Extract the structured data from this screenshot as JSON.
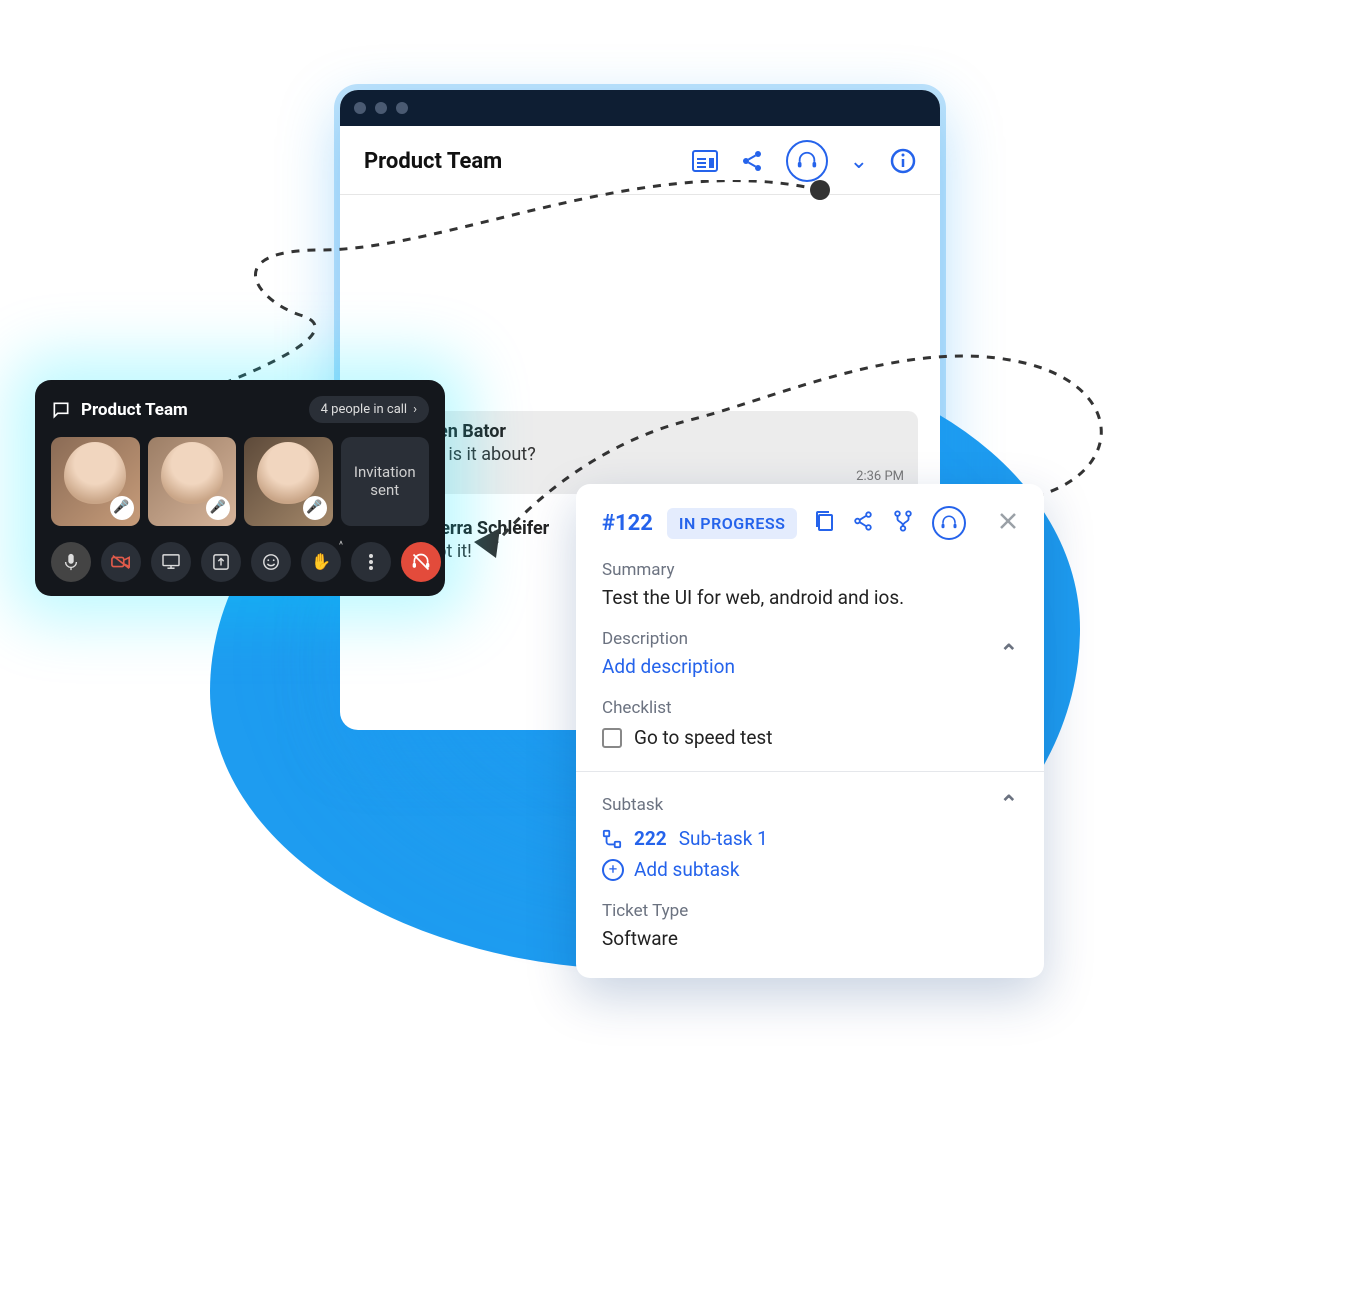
{
  "window": {
    "title": "Product Team",
    "messages": [
      {
        "name": "en Bator",
        "text": "t is it about?",
        "time": "2:36 PM"
      },
      {
        "name": "Kierra Schleifer",
        "text": "Got it!",
        "time": ""
      }
    ]
  },
  "call": {
    "title": "Product Team",
    "status": "4 people in call",
    "invite_label": "Invitation sent"
  },
  "ticket": {
    "id": "#122",
    "status": "IN PROGRESS",
    "summary_label": "Summary",
    "summary_text": "Test the UI for web, android and ios.",
    "description_label": "Description",
    "description_placeholder": "Add description",
    "checklist_label": "Checklist",
    "checklist_item": "Go to speed test",
    "subtask_label": "Subtask",
    "subtask_num": "222",
    "subtask_name": "Sub-task 1",
    "add_subtask_label": "Add subtask",
    "ticket_type_label": "Ticket Type",
    "ticket_type_value": "Software"
  }
}
